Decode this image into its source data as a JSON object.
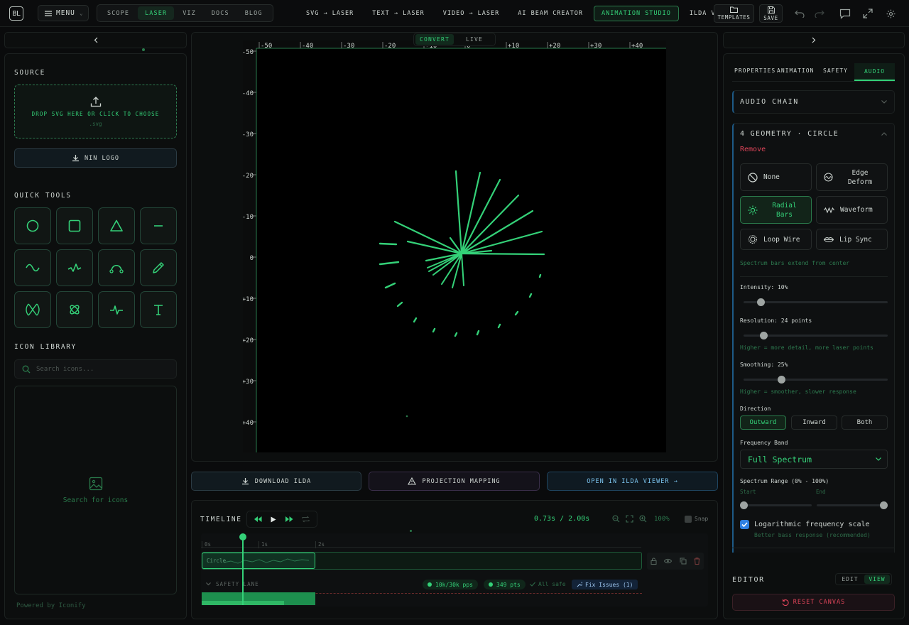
{
  "topbar": {
    "logo_text": "BL",
    "menu_label": "MENU",
    "main_tabs": [
      {
        "label": "SCOPE",
        "active": false
      },
      {
        "label": "LASER",
        "active": true
      },
      {
        "label": "VIZ",
        "active": false
      },
      {
        "label": "DOCS",
        "active": false
      },
      {
        "label": "BLOG",
        "active": false
      }
    ],
    "mode_tabs": [
      {
        "label": "SVG → LASER",
        "active": false
      },
      {
        "label": "TEXT → LASER",
        "active": false
      },
      {
        "label": "VIDEO → LASER",
        "active": false
      },
      {
        "label": "AI BEAM CREATOR",
        "active": false
      },
      {
        "label": "ANIMATION STUDIO",
        "active": true
      },
      {
        "label": "ILDA VIEWER",
        "active": false
      }
    ],
    "templates_label": "TEMPLATES",
    "save_label": "SAVE"
  },
  "left": {
    "source_title": "SOURCE",
    "dropzone_text": "DROP SVG HERE OR CLICK TO CHOOSE",
    "dropzone_ext": ".svg",
    "logo_button": "NIN LOGO",
    "quick_tools_title": "QUICK TOOLS",
    "tools": [
      "circle-tool",
      "square-tool",
      "triangle-tool",
      "line-tool",
      "wave-tool",
      "zigzag-tool",
      "arc-tool",
      "pencil-tool",
      "lissajous-tool",
      "spirograph-tool",
      "pulse-tool",
      "text-tool"
    ],
    "icon_library_title": "ICON LIBRARY",
    "search_placeholder": "Search icons...",
    "icon_hint": "Search for icons",
    "powered_by": "Powered by Iconify"
  },
  "canvas": {
    "toggle": [
      {
        "label": "CONVERT",
        "active": true
      },
      {
        "label": "LIVE",
        "active": false
      }
    ],
    "x_ticks": [
      "-50",
      "-40",
      "-30",
      "-20",
      "-10",
      "0",
      "+10",
      "+20",
      "+30",
      "+40"
    ],
    "y_ticks": [
      "-50",
      "-40",
      "-30",
      "-20",
      "-10",
      "0",
      "+10",
      "+20",
      "+30",
      "+40"
    ],
    "accent": "#34d178"
  },
  "actions": {
    "download": "DOWNLOAD ILDA",
    "projection": "PROJECTION MAPPING",
    "open_viewer": "OPEN IN ILDA VIEWER →"
  },
  "timeline": {
    "title": "TIMELINE",
    "time_readout": "0.73s / 2.00s",
    "zoom": "100%",
    "snap_label": "Snap",
    "ruler": [
      "0s",
      "1s",
      "2s"
    ],
    "clip_label": "Circle",
    "safety_lane_label": "SAFETY LANE",
    "badges": {
      "pps": "10k/30k pps",
      "pts": "349 pts",
      "safe": "All safe",
      "fix": "Fix Issues (1)"
    }
  },
  "right": {
    "tabs": [
      {
        "label": "PROPERTIES",
        "active": false
      },
      {
        "label": "ANIMATION",
        "active": false
      },
      {
        "label": "SAFETY",
        "active": false
      },
      {
        "label": "AUDIO",
        "active": true
      }
    ],
    "audio_chain_title": "AUDIO CHAIN",
    "geometry_title": "4 GEOMETRY · CIRCLE",
    "remove_label": "Remove",
    "modes": [
      {
        "label": "None",
        "active": false
      },
      {
        "label": "Edge Deform",
        "active": false
      },
      {
        "label": "Radial Bars",
        "active": true
      },
      {
        "label": "Waveform",
        "active": false
      },
      {
        "label": "Loop Wire",
        "active": false
      },
      {
        "label": "Lip Sync",
        "active": false
      }
    ],
    "mode_help": "Spectrum bars extend from center",
    "intensity_label": "Intensity: 10%",
    "intensity": 0.1,
    "resolution_label": "Resolution: 24 points",
    "resolution": 0.12,
    "resolution_help": "Higher = more detail, more laser points",
    "smoothing_label": "Smoothing: 25%",
    "smoothing": 0.25,
    "smoothing_help": "Higher = smoother, slower response",
    "direction_label": "Direction",
    "directions": [
      {
        "label": "Outward",
        "active": true
      },
      {
        "label": "Inward",
        "active": false
      },
      {
        "label": "Both",
        "active": false
      }
    ],
    "freq_band_label": "Frequency Band",
    "freq_band_value": "Full Spectrum",
    "spectrum_range_label": "Spectrum Range (0% - 100%)",
    "start_label": "Start",
    "end_label": "End",
    "range_start": 0,
    "range_end": 100,
    "log_label": "Logarithmic frequency scale",
    "log_help": "Better bass response (recommended)",
    "log_checked": true,
    "editor_title": "EDITOR",
    "editor_tabs": [
      {
        "label": "EDIT",
        "active": false
      },
      {
        "label": "VIEW",
        "active": true
      }
    ],
    "reset_label": "RESET CANVAS"
  }
}
